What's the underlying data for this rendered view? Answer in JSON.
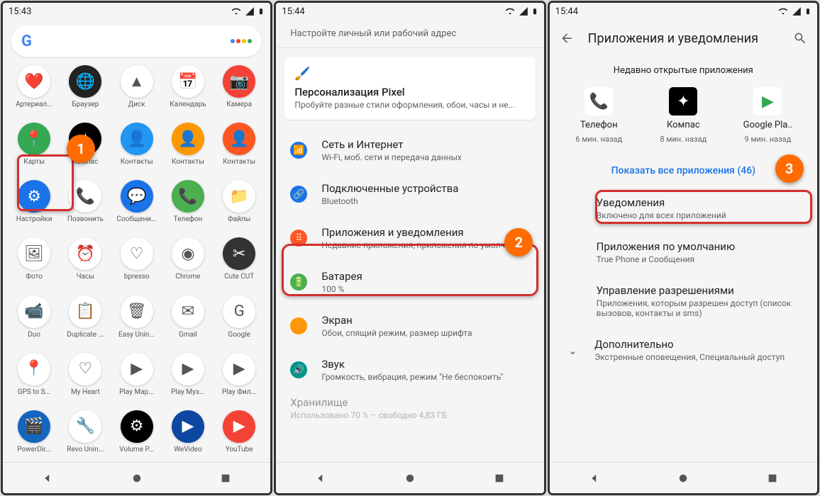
{
  "screen1": {
    "time": "15:43",
    "apps": [
      {
        "label": "Артериал...",
        "bg": "#fff"
      },
      {
        "label": "Браузер",
        "bg": "#222"
      },
      {
        "label": "Диск",
        "bg": "#fff"
      },
      {
        "label": "Календарь",
        "bg": "#fff"
      },
      {
        "label": "Камера",
        "bg": "#f44336"
      },
      {
        "label": "Карты",
        "bg": "#34a853"
      },
      {
        "label": "Компас",
        "bg": "#000"
      },
      {
        "label": "Контакты",
        "bg": "#2196f3"
      },
      {
        "label": "Контакты",
        "bg": "#ff9800"
      },
      {
        "label": "Контакты",
        "bg": "#ff5722"
      },
      {
        "label": "Настройки",
        "bg": "#1a73e8"
      },
      {
        "label": "Позвонить",
        "bg": "#fff"
      },
      {
        "label": "Сообщени...",
        "bg": "#1a73e8"
      },
      {
        "label": "Телефон",
        "bg": "#4caf50"
      },
      {
        "label": "Файлы",
        "bg": "#fff"
      },
      {
        "label": "Фото",
        "bg": "#fff"
      },
      {
        "label": "Часы",
        "bg": "#fff"
      },
      {
        "label": "bpresso",
        "bg": "#fff"
      },
      {
        "label": "Chrome",
        "bg": "#fff"
      },
      {
        "label": "Cute CUT",
        "bg": "#333"
      },
      {
        "label": "Duo",
        "bg": "#fff"
      },
      {
        "label": "Duplicate ...",
        "bg": "#fff"
      },
      {
        "label": "Easy Unin...",
        "bg": "#fff"
      },
      {
        "label": "Gmail",
        "bg": "#fff"
      },
      {
        "label": "Google",
        "bg": "#fff"
      },
      {
        "label": "GPS to S...",
        "bg": "#fff"
      },
      {
        "label": "My Heart",
        "bg": "#fff"
      },
      {
        "label": "Play Мар...",
        "bg": "#fff"
      },
      {
        "label": "Play Муз...",
        "bg": "#fff"
      },
      {
        "label": "Play Фил...",
        "bg": "#fff"
      },
      {
        "label": "PowerDir...",
        "bg": "#1565c0"
      },
      {
        "label": "Revo Unin...",
        "bg": "#fff"
      },
      {
        "label": "Volume P...",
        "bg": "#000"
      },
      {
        "label": "WeVideo",
        "bg": "#0d47a1"
      },
      {
        "label": "YouTube",
        "bg": "#f44336"
      }
    ]
  },
  "screen2": {
    "time": "15:44",
    "hint": "Настройте личный или рабочий адрес",
    "card": {
      "title": "Персонализация Pixel",
      "sub": "Пробуйте разные стили оформления, обои, часы и не..."
    },
    "rows": [
      {
        "icon_bg": "#1a73e8",
        "glyph": "📶",
        "title": "Сеть и Интернет",
        "sub": "Wi-Fi, моб. сети и передача данных"
      },
      {
        "icon_bg": "#1a73e8",
        "glyph": "🔗",
        "title": "Подключенные устройства",
        "sub": "Bluetooth"
      },
      {
        "icon_bg": "#ff5722",
        "glyph": "⠿",
        "title": "Приложения и уведомления",
        "sub": "Недавние приложения, приложения по умолчанию"
      },
      {
        "icon_bg": "#4caf50",
        "glyph": "🔋",
        "title": "Батарея",
        "sub": "100 %"
      },
      {
        "icon_bg": "#ff9800",
        "glyph": "🔆",
        "title": "Экран",
        "sub": "Обои, спящий режим, размер шрифта"
      },
      {
        "icon_bg": "#009688",
        "glyph": "🔊",
        "title": "Звук",
        "sub": "Громкость, вибрация, режим \"Не беспокоить\""
      }
    ],
    "storage": {
      "title": "Хранилище",
      "sub": "Использовано 70 % – свободно 4,83 ГБ"
    }
  },
  "screen3": {
    "time": "15:44",
    "title": "Приложения и уведомления",
    "section": "Недавно открытые приложения",
    "recent": [
      {
        "name": "Телефон",
        "time": "6 мин. назад",
        "bg": "#fff",
        "glyph": "📞",
        "col": "#1a73e8"
      },
      {
        "name": "Компас",
        "time": "8 мин. назад",
        "bg": "#000",
        "glyph": "✦",
        "col": "#fff"
      },
      {
        "name": "Google Pla..",
        "time": "9 мин. назад",
        "bg": "#fff",
        "glyph": "▶",
        "col": "#34a853"
      }
    ],
    "show_all": "Показать все приложения (46)",
    "rows": [
      {
        "title": "Уведомления",
        "sub": "Включено для всех приложений"
      },
      {
        "title": "Приложения по умолчанию",
        "sub": "True Phone и Сообщения"
      },
      {
        "title": "Управление разрешениями",
        "sub": "Приложения, которым разрешен доступ (список вызовов, контакты и sms)"
      }
    ],
    "more": {
      "title": "Дополнительно",
      "sub": "Экстренные оповещения, Специальный доступ"
    }
  }
}
